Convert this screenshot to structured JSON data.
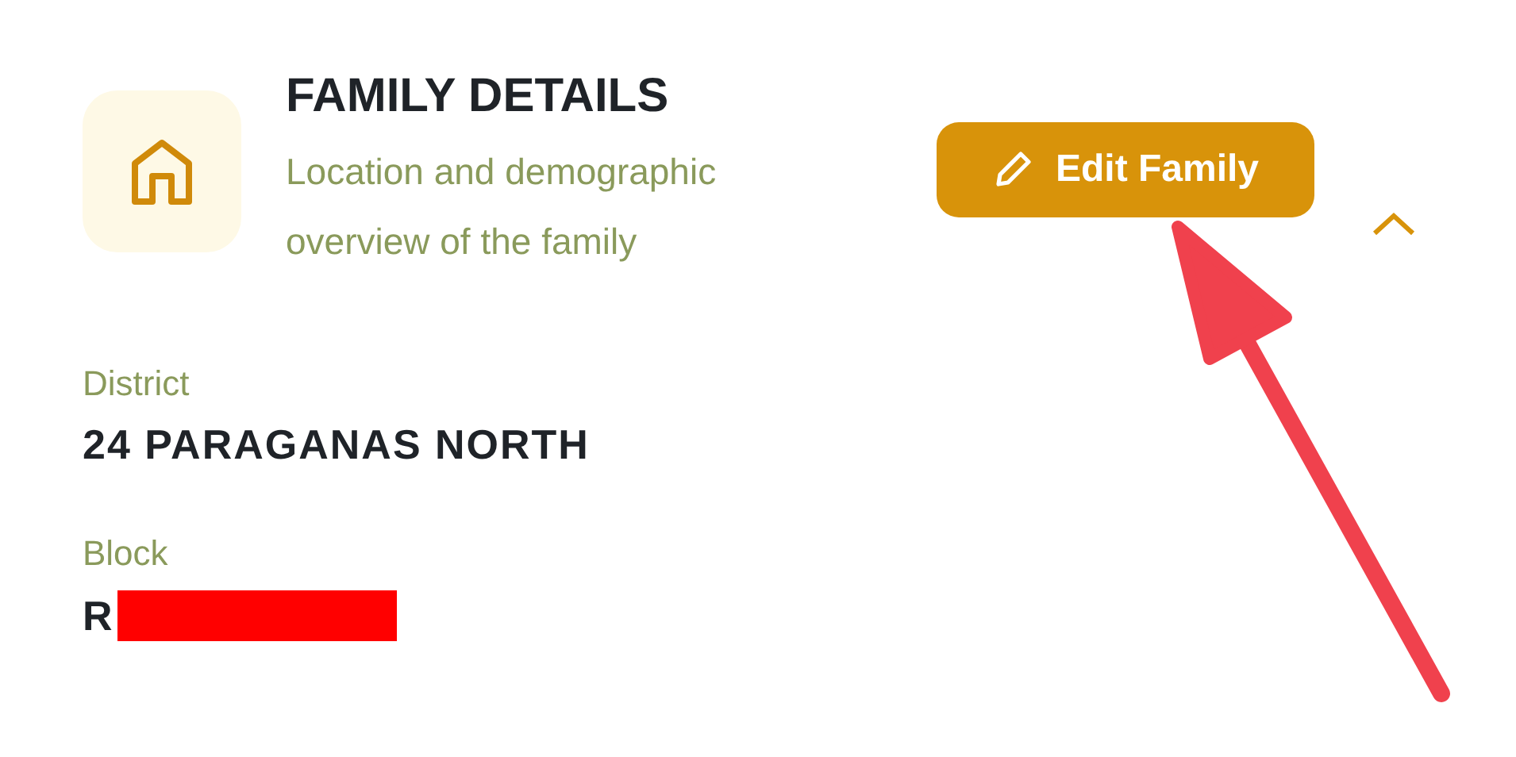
{
  "header": {
    "title": "FAMILY DETAILS",
    "subtitle": "Location and demographic overview of the family",
    "edit_button": "Edit Family",
    "expanded": true
  },
  "fields": [
    {
      "label": "District",
      "value": "24 PARAGANAS NORTH",
      "redacted": false
    },
    {
      "label": "Block",
      "value": "R",
      "redacted": true
    }
  ],
  "annotation": {
    "kind": "arrow"
  }
}
